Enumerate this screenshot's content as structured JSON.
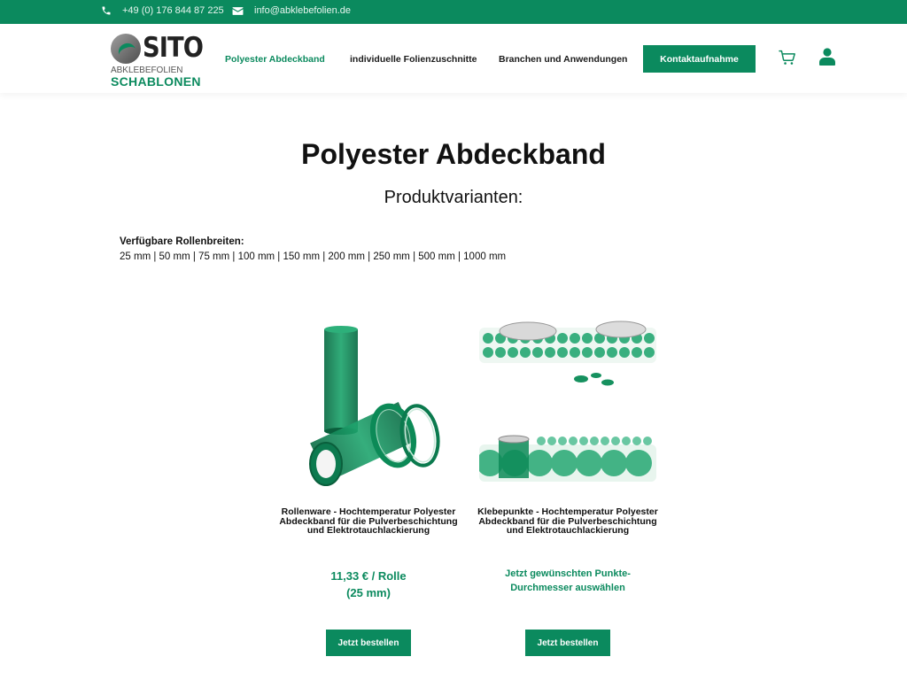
{
  "topbar": {
    "phone": "+49 (0) 176 844 87 225",
    "email": "info@abklebefolien.de"
  },
  "logo": {
    "brand": "SITO",
    "line2": "ABKLEBEFOLIEN",
    "line3": "SCHABLONEN"
  },
  "nav": {
    "items": [
      {
        "label": "Polyester Abdeckband",
        "active": true
      },
      {
        "label": "individuelle Folienzuschnitte",
        "active": false
      },
      {
        "label": "Branchen und Anwendungen",
        "active": false
      }
    ],
    "cta": "Kontaktaufnahme"
  },
  "page": {
    "title": "Polyester Abdeckband",
    "subtitle": "Produktvarianten:",
    "rolls_label": "Verfügbare Rollenbreiten:",
    "rolls_values": "25 mm | 50 mm | 75 mm | 100 mm | 150 mm | 200 mm | 250 mm | 500 mm | 1000 mm"
  },
  "products": [
    {
      "title": "Rollenware - Hochtemperatur Polyester Abdeckband für die Pulverbeschichtung und Elektrotauchlackierung",
      "price_line1": "11,33 € / Rolle",
      "price_line2": "(25 mm)",
      "button": "Jetzt bestellen"
    },
    {
      "title": "Klebepunkte - Hochtemperatur Polyester Abdeckband für die Pulverbeschichtung und Elektrotauchlackierung",
      "price_line1": "Jetzt gewünschten Punkte-",
      "price_line2": "Durchmesser auswählen",
      "button": "Jetzt bestellen"
    }
  ],
  "colors": {
    "brand_green": "#0b8a5e",
    "text": "#111111"
  },
  "icons": [
    "phone-icon",
    "envelope-icon",
    "cart-icon",
    "user-icon"
  ]
}
